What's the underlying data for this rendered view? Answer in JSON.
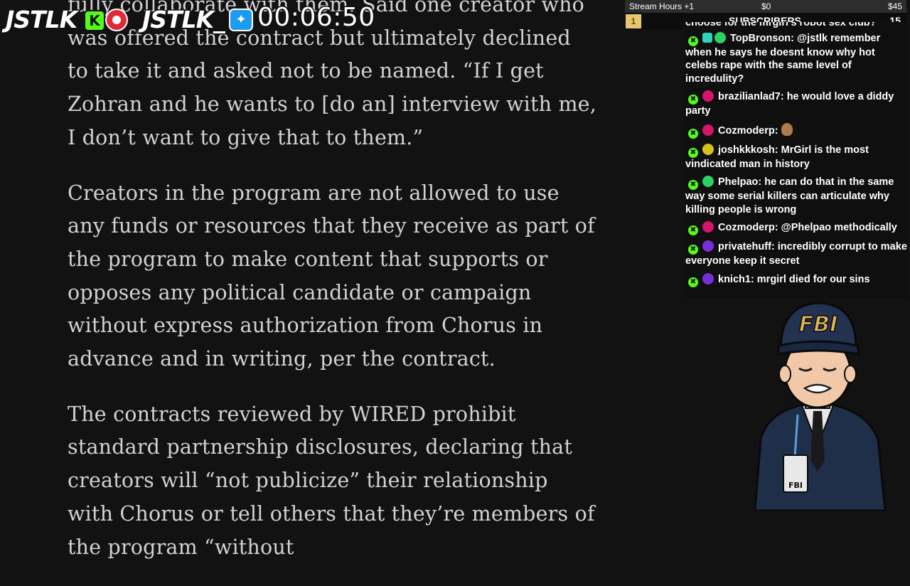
{
  "overlay": {
    "brand_left": "JSTLK",
    "kick_badge": "K",
    "brand_right": "JSTLK_",
    "twitter_badge": "★",
    "timer": "00:06:50"
  },
  "stats": {
    "stream_hours": "Stream Hours +1",
    "sub_money": "$0",
    "money": "$45",
    "count": "1",
    "label": "SUBSCRIBERS",
    "goal": "15"
  },
  "article": {
    "paragraphs": [
      "fully collaborate with them. Said one creator who was offered the contract but ultimately declined to take it and asked not to be named. “If I get Zohran and he wants to [do an] interview with me, I don’t want to give that to them.”",
      "Creators in the program are not allowed to use any funds or resources that they receive as part of the program to make content that supports or opposes any political candidate or campaign without express authorization from Chorus in advance and in writing, per the contract.",
      "The contracts reviewed by WIRED prohibit standard partnership disclosures, declaring that creators will “not publicize” their relationship with Chorus or tell others that they’re members of the program “without"
    ]
  },
  "chat": {
    "cutoff_text": "choose for the mrgirl's robot sex club?",
    "messages": [
      {
        "user": "TopBronson:",
        "text": " @jstlk remember when he says he doesnt know why hot celebs rape with the same level of incredulity?",
        "dot_color": "#2bd163",
        "extra_badge": true,
        "emote": false
      },
      {
        "user": "brazilianlad7:",
        "text": " he would love a diddy party",
        "dot_color": "#d4156a",
        "extra_badge": false,
        "emote": false
      },
      {
        "user": "Cozmoderp:",
        "text": "",
        "dot_color": "#d4156a",
        "extra_badge": false,
        "emote": true
      },
      {
        "user": "joshkkkosh:",
        "text": " MrGirl is the most vindicated man in history",
        "dot_color": "#d8c21a",
        "extra_badge": false,
        "emote": false
      },
      {
        "user": "Phelpao:",
        "text": " he can do that in the same way some serial killers can articulate why killing people is wrong",
        "dot_color": "#2bd163",
        "extra_badge": false,
        "emote": false
      },
      {
        "user": "Cozmoderp:",
        "text": " @Phelpao methodically",
        "dot_color": "#d4156a",
        "extra_badge": false,
        "emote": false
      },
      {
        "user": "privatehuff:",
        "text": " incredibly corrupt to make everyone keep it secret",
        "dot_color": "#7a2fd6",
        "extra_badge": false,
        "emote": false
      },
      {
        "user": "knich1:",
        "text": " mrgirl died for our sins",
        "dot_color": "#7a2fd6",
        "extra_badge": false,
        "emote": false
      }
    ]
  },
  "avatar": {
    "cap_text": "FBI",
    "badge_text": "FBI"
  }
}
